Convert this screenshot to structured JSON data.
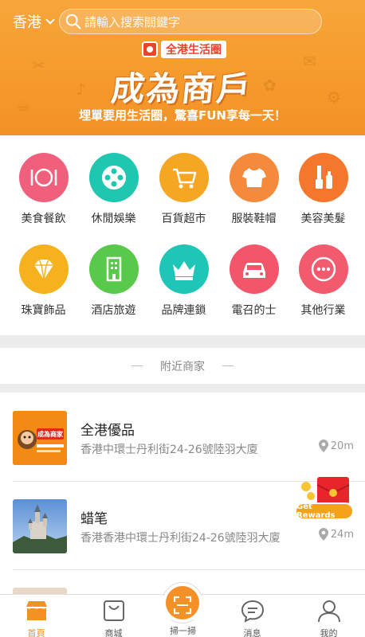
{
  "header": {
    "city": "香港",
    "search_placeholder": "請輸入搜索關鍵字"
  },
  "banner": {
    "brand": "全港生活圈",
    "headline": "成為商戶",
    "slogan": "埋單要用生活圈，驚喜FUN享每一天！"
  },
  "categories": [
    {
      "label": "美食餐飲",
      "icon": "dining-icon",
      "color": "#f0607c"
    },
    {
      "label": "休閒娛樂",
      "icon": "film-reel-icon",
      "color": "#1fc6b0"
    },
    {
      "label": "百貨超市",
      "icon": "shopping-cart-icon",
      "color": "#f5a623"
    },
    {
      "label": "服裝鞋帽",
      "icon": "tshirt-icon",
      "color": "#f58a3c"
    },
    {
      "label": "美容美髮",
      "icon": "cosmetics-icon",
      "color": "#f5772b"
    },
    {
      "label": "珠寶飾品",
      "icon": "diamond-icon",
      "color": "#f5b21e"
    },
    {
      "label": "酒店旅遊",
      "icon": "hotel-building-icon",
      "color": "#58c94a"
    },
    {
      "label": "品牌連鎖",
      "icon": "crown-icon",
      "color": "#1fc6b8"
    },
    {
      "label": "電召的士",
      "icon": "taxi-car-icon",
      "color": "#f2566b"
    },
    {
      "label": "其他行業",
      "icon": "more-dots-icon",
      "color": "#f25a6e"
    }
  ],
  "nearby": {
    "title": "附近商家",
    "items": [
      {
        "name": "全港優品",
        "address": "香港中環士丹利街24-26號陸羽大廈",
        "distance": "20m",
        "thumb_text": "成為商家"
      },
      {
        "name": "蜡笔",
        "address": "香港香港中環士丹利街24-26號陸羽大廈",
        "distance": "24m"
      }
    ]
  },
  "rewards": {
    "label": "Get Rewards"
  },
  "tabbar": {
    "tabs": [
      {
        "label": "首頁",
        "icon": "storefront-icon"
      },
      {
        "label": "商城",
        "icon": "shopping-bag-icon"
      },
      {
        "label": "掃一掃",
        "icon": "scan-icon"
      },
      {
        "label": "消息",
        "icon": "message-bubble-icon"
      },
      {
        "label": "我的",
        "icon": "user-icon"
      }
    ]
  },
  "colors": {
    "accent": "#f39126",
    "banner": "#f7a63a"
  }
}
